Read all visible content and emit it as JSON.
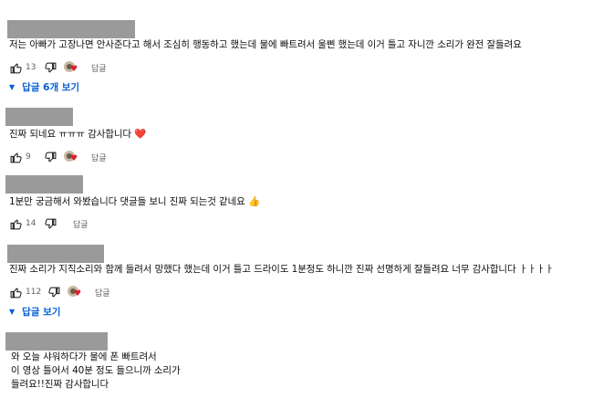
{
  "comments": [
    {
      "text": "저는 아빠가 고장나면 안사준다고 해서 조심히 행동하고 했는데 물에 빠트려서 울삔 했는데 이거 틀고 자니깐 소리가 완전 잘들려요",
      "likes": "13",
      "reply_label": "답글",
      "replies_label": "답글 6개 보기"
    },
    {
      "text": "진짜 되네요 ㅠㅠㅠ 감사합니다",
      "emoji": "❤️",
      "likes": "9",
      "reply_label": "답글"
    },
    {
      "text": "1분만 궁금해서 와봤습니다 댓글들 보니 진짜 되는것 같네요",
      "emoji": "👍",
      "likes": "14",
      "reply_label": "답글"
    },
    {
      "text": "진짜 소리가 지직소리와 함께 들려서 망했다 했는데 이거 틀고 드라이도 1분정도 하니깐 진짜 선명하게 잘들려요 너무 감사합니다 ㅏㅏㅏㅏ",
      "likes": "112",
      "reply_label": "답글",
      "replies_label": "답글 보기"
    },
    {
      "text_lines": [
        "와 오늘 샤워하다가 물에 폰 빠트려서",
        "이 영상 틀어서 40분 정도 들으니까 소리가",
        "들려요!!진짜 감사합니다"
      ]
    }
  ],
  "colors": {
    "link_blue": "#065fd4",
    "heart_red": "#e01e2c",
    "redacted_gray": "#9a9a9a"
  },
  "icons": [
    "thumbs-up-icon",
    "thumbs-down-icon",
    "creator-heart-icon",
    "caret-down-icon"
  ]
}
